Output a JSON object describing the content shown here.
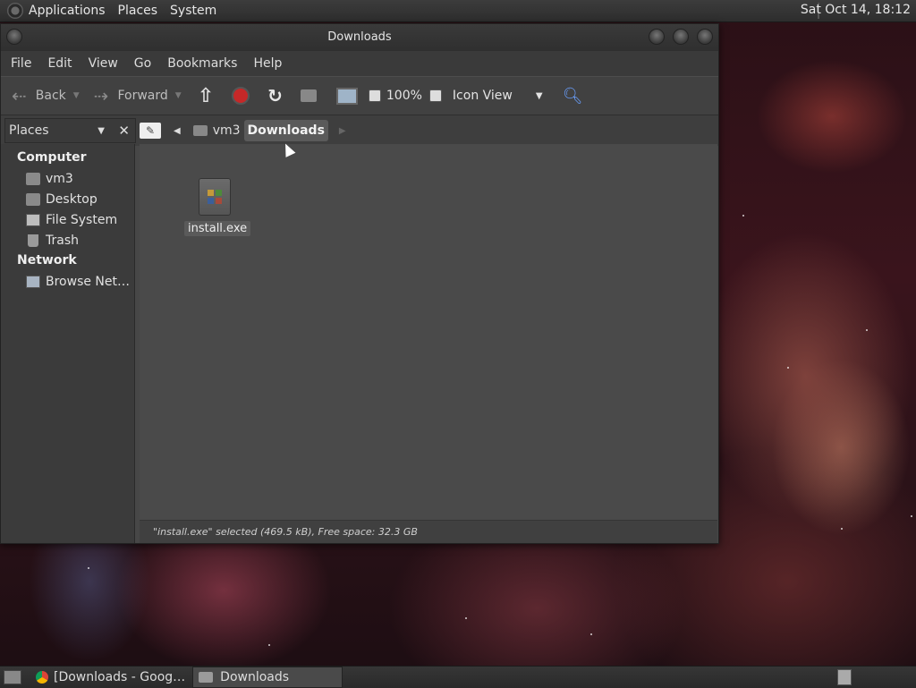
{
  "top_panel": {
    "menus": [
      "Applications",
      "Places",
      "System"
    ],
    "clock": "Sat Oct 14, 18:12"
  },
  "window": {
    "title": "Downloads",
    "menubar": [
      "File",
      "Edit",
      "View",
      "Go",
      "Bookmarks",
      "Help"
    ],
    "toolbar": {
      "back_label": "Back",
      "forward_label": "Forward",
      "zoom_level": "100%",
      "view_mode": "Icon View"
    },
    "places_header": "Places",
    "pathbar": [
      "vm3",
      "Downloads"
    ],
    "sidebar": {
      "computer_heading": "Computer",
      "computer_items": [
        {
          "label": "vm3",
          "icon": "home-folder-icon"
        },
        {
          "label": "Desktop",
          "icon": "desktop-folder-icon"
        },
        {
          "label": "File System",
          "icon": "drive-icon"
        },
        {
          "label": "Trash",
          "icon": "trash-icon"
        }
      ],
      "network_heading": "Network",
      "network_items": [
        {
          "label": "Browse Net…",
          "icon": "network-icon"
        }
      ]
    },
    "files": [
      {
        "name": "install.exe",
        "icon": "executable-icon",
        "selected": true
      }
    ],
    "status": "\"install.exe\" selected (469.5 kB), Free space: 32.3 GB"
  },
  "taskbar": {
    "tasks": [
      {
        "label": "[Downloads - Goog…",
        "icon": "chrome-icon",
        "active": false
      },
      {
        "label": "Downloads",
        "icon": "folder-icon",
        "active": true
      }
    ]
  },
  "colors": {
    "window_bg": "#474747",
    "panel_bg": "#2d2d2d",
    "accent_red": "#c62828"
  }
}
